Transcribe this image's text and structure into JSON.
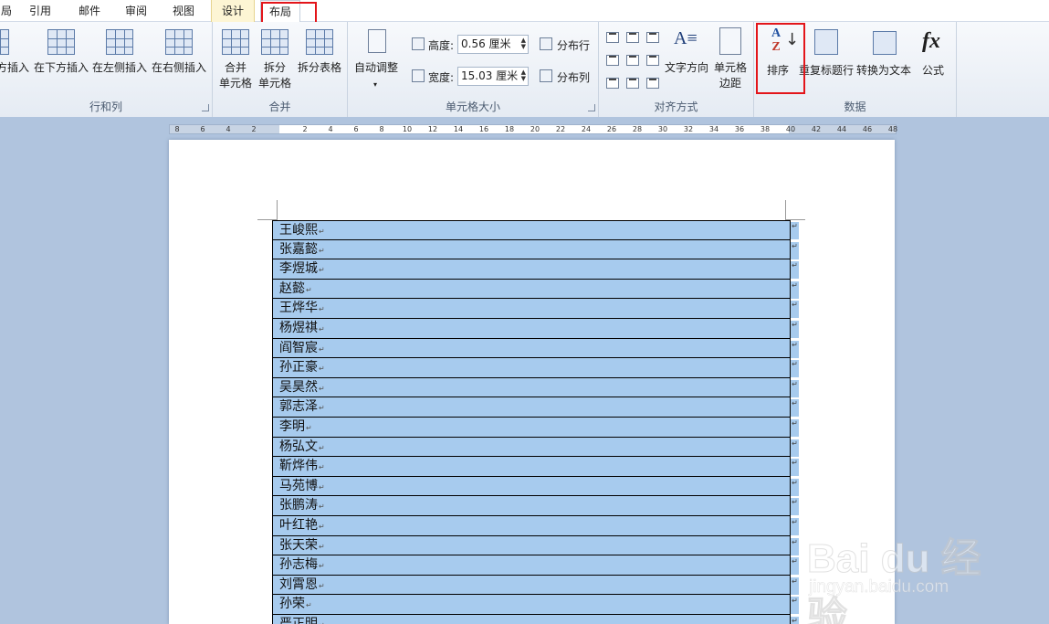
{
  "tabs": [
    {
      "label": "局"
    },
    {
      "label": "引用"
    },
    {
      "label": "邮件"
    },
    {
      "label": "审阅"
    },
    {
      "label": "视图"
    },
    {
      "label": "设计"
    },
    {
      "label": "布局"
    }
  ],
  "ribbon": {
    "rows_cols": {
      "label": "行和列",
      "buttons": [
        "方插入",
        "在下方插入",
        "在左侧插入",
        "在右侧插入"
      ]
    },
    "merge": {
      "label": "合并",
      "buttons": [
        "合并\n单元格",
        "拆分\n单元格",
        "拆分表格"
      ]
    },
    "cell_size": {
      "label": "单元格大小",
      "autofit": "自动调整",
      "height_label": "高度:",
      "height_value": "0.56 厘米",
      "width_label": "宽度:",
      "width_value": "15.03 厘米",
      "distribute_rows": "分布行",
      "distribute_cols": "分布列"
    },
    "alignment": {
      "label": "对齐方式",
      "text_direction": "文字方向",
      "cell_margins": "单元格\n边距"
    },
    "data": {
      "label": "数据",
      "sort": "排序",
      "repeat_header": "重复标题行",
      "convert": "转换为文本",
      "formula": "公式"
    }
  },
  "ruler_numbers": [
    "8",
    "6",
    "4",
    "2",
    "2",
    "4",
    "6",
    "8",
    "10",
    "12",
    "14",
    "16",
    "18",
    "20",
    "22",
    "24",
    "26",
    "28",
    "30",
    "32",
    "34",
    "36",
    "38",
    "40",
    "42",
    "44",
    "46",
    "48"
  ],
  "table_rows": [
    "王峻熙",
    "张嘉懿",
    "李煜城",
    "赵懿",
    "王烨华",
    "杨煜祺",
    "阎智宸",
    "孙正豪",
    "吴昊然",
    "郭志泽",
    "李明",
    "杨弘文",
    "靳烨伟",
    "马苑博",
    "张鹏涛",
    "叶红艳",
    "张天荣",
    "孙志梅",
    "刘霄恩",
    "孙荣",
    "严正明"
  ],
  "watermark": {
    "big": "Bai du 经验",
    "small": "jingyan.baidu.com"
  },
  "colors": {
    "selection": "#a7cbee",
    "highlight_box": "#e3151a"
  }
}
